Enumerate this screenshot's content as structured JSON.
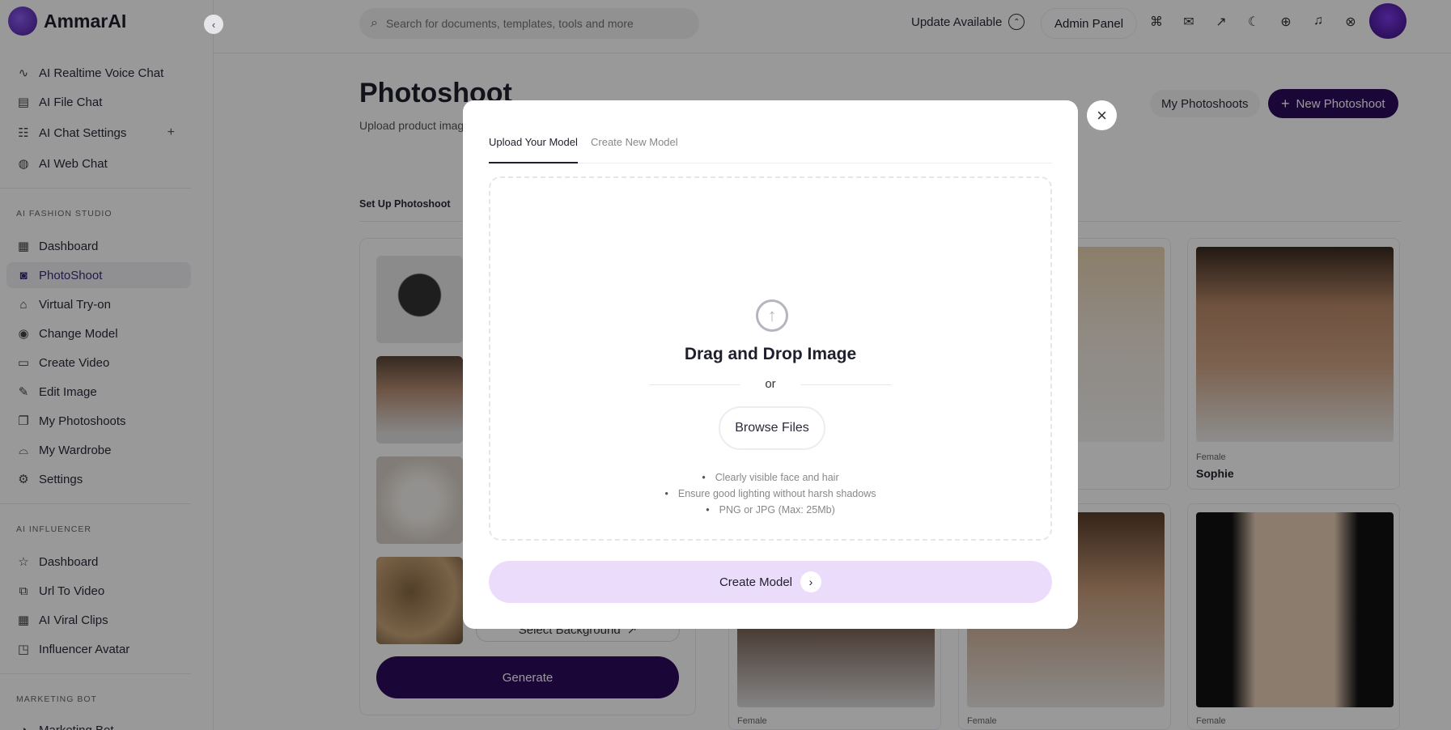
{
  "app": {
    "name": "AmmarAI"
  },
  "sidebar": {
    "top_items": [
      {
        "label": "AI Realtime Voice Chat",
        "icon": "waveform-icon"
      },
      {
        "label": "AI File Chat",
        "icon": "file-icon"
      },
      {
        "label": "AI Chat Settings",
        "icon": "chat-settings-icon"
      },
      {
        "label": "AI Web Chat",
        "icon": "globe-icon"
      }
    ],
    "sections": [
      {
        "title": "AI FASHION STUDIO",
        "items": [
          {
            "label": "Dashboard",
            "icon": "grid-icon"
          },
          {
            "label": "PhotoShoot",
            "icon": "camera-icon",
            "active": true
          },
          {
            "label": "Virtual Try-on",
            "icon": "shirt-icon"
          },
          {
            "label": "Change Model",
            "icon": "user-circle-icon"
          },
          {
            "label": "Create Video",
            "icon": "video-icon"
          },
          {
            "label": "Edit Image",
            "icon": "pencil-icon"
          },
          {
            "label": "My Photoshoots",
            "icon": "copy-icon"
          },
          {
            "label": "My Wardrobe",
            "icon": "hanger-icon"
          },
          {
            "label": "Settings",
            "icon": "gear-icon"
          }
        ]
      },
      {
        "title": "AI INFLUENCER",
        "items": [
          {
            "label": "Dashboard",
            "icon": "star-icon"
          },
          {
            "label": "Url To Video",
            "icon": "link-video-icon"
          },
          {
            "label": "AI Viral Clips",
            "icon": "film-icon"
          },
          {
            "label": "Influencer Avatar",
            "icon": "avatar-icon"
          }
        ]
      },
      {
        "title": "MARKETING BOT",
        "items": [
          {
            "label": "Marketing Bot",
            "icon": "bot-icon"
          }
        ]
      }
    ]
  },
  "topbar": {
    "search_placeholder": "Search for documents, templates, tools and more",
    "update_label": "Update Available",
    "admin_label": "Admin Panel"
  },
  "main": {
    "title": "Photoshoot",
    "subtitle": "Upload product imag",
    "my_photoshoots": "My Photoshoots",
    "new_photoshoot": "New Photoshoot",
    "setup_label": "Set Up Photoshoot",
    "select_background": "Select Background",
    "generate": "Generate",
    "cards": [
      {
        "gender": "",
        "name": ""
      },
      {
        "gender": "Female",
        "name": "Sophie"
      },
      {
        "gender": "Female",
        "name": ""
      },
      {
        "gender": "Female",
        "name": ""
      },
      {
        "gender": "Female",
        "name": ""
      }
    ]
  },
  "modal": {
    "tabs": [
      "Upload Your Model",
      "Create New Model"
    ],
    "drop_title": "Drag and Drop Image",
    "or": "or",
    "browse": "Browse Files",
    "tips": [
      "Clearly visible face and hair",
      "Ensure good lighting without harsh shadows",
      "PNG or JPG (Max: 25Mb)"
    ],
    "create_model": "Create Model"
  },
  "colors": {
    "accent": "#2d0a5e",
    "create_bg": "#ecdcfb"
  }
}
